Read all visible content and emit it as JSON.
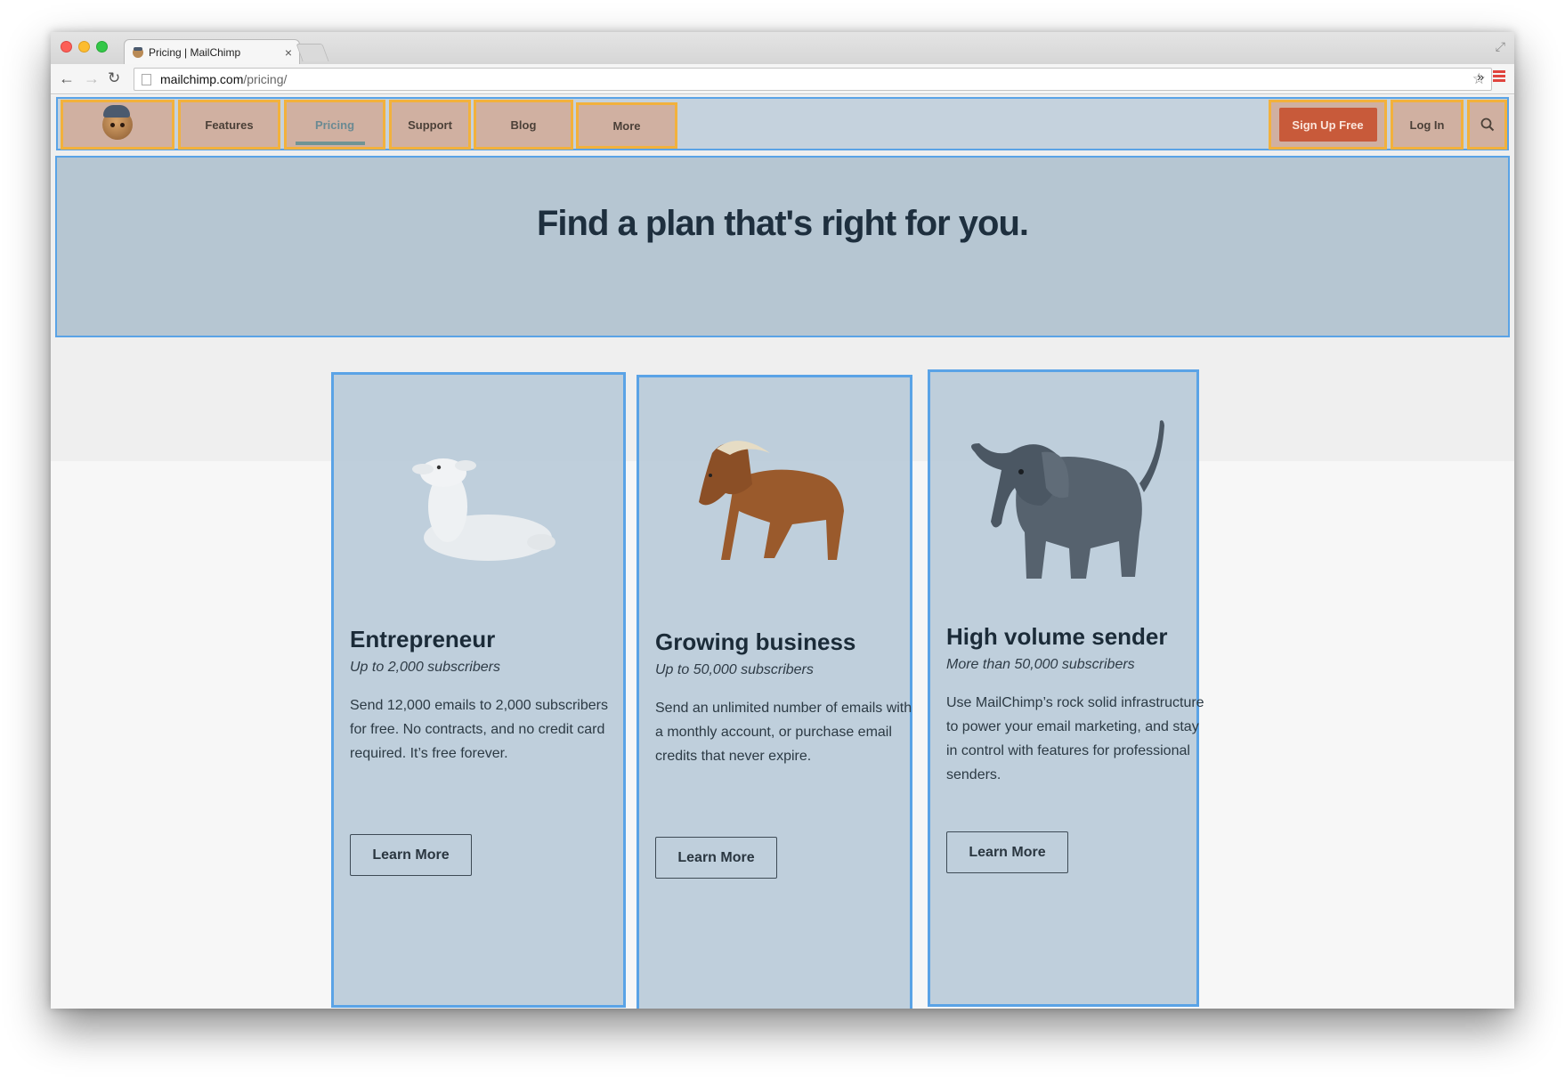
{
  "browser": {
    "tab_title": "Pricing | MailChimp",
    "tab_close": "×",
    "url_host": "mailchimp.com",
    "url_path": "/pricing/",
    "icons": [
      "back-arrow-icon",
      "forward-arrow-icon",
      "reload-icon",
      "star-icon",
      "extensions-icon",
      "menu-icon",
      "fullscreen-icon"
    ]
  },
  "nav": {
    "items": [
      {
        "label": "Features"
      },
      {
        "label": "Pricing",
        "active": true
      },
      {
        "label": "Support"
      },
      {
        "label": "Blog"
      },
      {
        "label": "More"
      }
    ],
    "signup_label": "Sign Up Free",
    "login_label": "Log In"
  },
  "hero": {
    "title": "Find a plan that's right for you."
  },
  "plans": [
    {
      "animal": "lamb",
      "title": "Entrepreneur",
      "subtitle": "Up to 2,000 subscribers",
      "description": "Send 12,000 emails to 2,000 subscribers for free. No contracts, and no credit card required. It’s free forever.",
      "button": "Learn More"
    },
    {
      "animal": "horse",
      "title": "Growing business",
      "subtitle": "Up to 50,000 subscribers",
      "description": "Send an unlimited number of emails with a monthly account, or purchase email credits that never expire.",
      "button": "Learn More"
    },
    {
      "animal": "elephant",
      "title": "High volume sender",
      "subtitle": "More than 50,000 subscribers",
      "description": "Use MailChimp’s rock solid infrastructure to power your email marketing, and stay in control with features for professional senders.",
      "button": "Learn More"
    }
  ],
  "colors": {
    "annotation_blue": "#5aa3e6",
    "annotation_orange": "#f2b13c",
    "signup_button": "#c85a3a",
    "heading": "#1e2f3e"
  }
}
